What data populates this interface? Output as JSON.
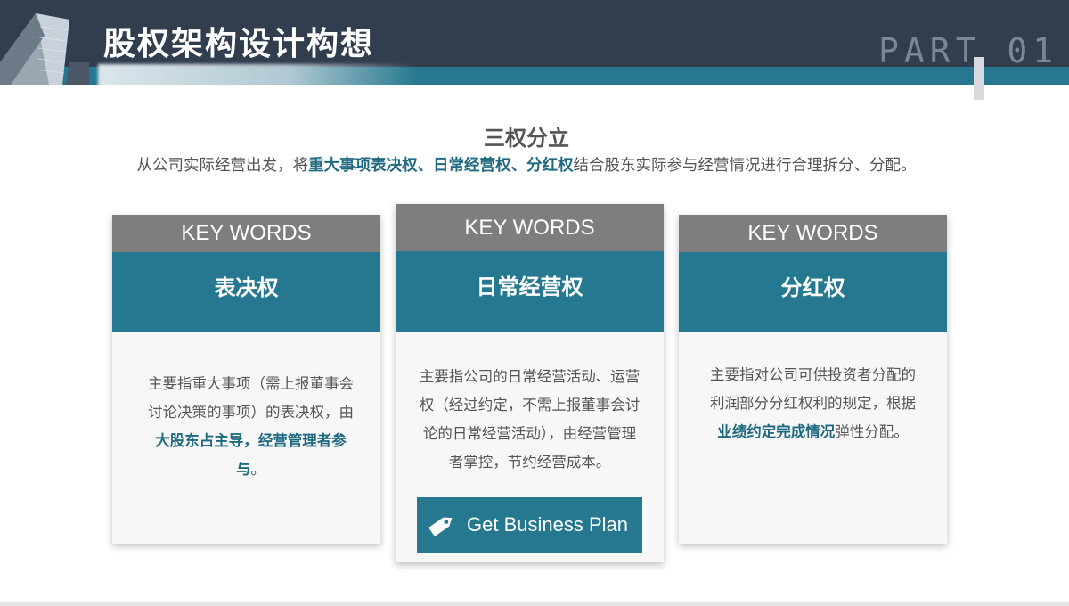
{
  "header": {
    "title": "股权架构设计构想",
    "part": "PART 01"
  },
  "intro": {
    "title": "三权分立",
    "desc_pre": "从公司实际经营出发，将",
    "desc_hl": "重大事项表决权、日常经营权、分红权",
    "desc_post": "结合股东实际参与经营情况进行合理拆分、分配。"
  },
  "cards": [
    {
      "keywords": "KEY WORDS",
      "heading": "表决权",
      "body_pre": "主要指重大事项（需上报董事会讨论决策的事项）的表决权，由",
      "body_hl": "大股东占主导，经营管理者参与",
      "body_post": "。"
    },
    {
      "keywords": "KEY WORDS",
      "heading": "日常经营权",
      "body": "主要指公司的日常经营活动、运营权（经过约定，不需上报董事会讨论的日常经营活动），由经营管理者掌控，节约经营成本。",
      "cta_label": "Get Business Plan"
    },
    {
      "keywords": "KEY WORDS",
      "heading": "分红权",
      "body_pre": "主要指对公司可供投资者分配的利润部分分红权利的规定，根据",
      "body_hl": "业绩约定完成情况",
      "body_post": "弹性分配。"
    }
  ],
  "colors": {
    "header_dark": "#323d4e",
    "accent_teal": "#25788f",
    "keyword_gray": "#7e7e7e",
    "card_bg": "#f7f7f7"
  },
  "icons": {
    "cta_icon": "price-tag-icon",
    "header_image": "building-icon"
  }
}
